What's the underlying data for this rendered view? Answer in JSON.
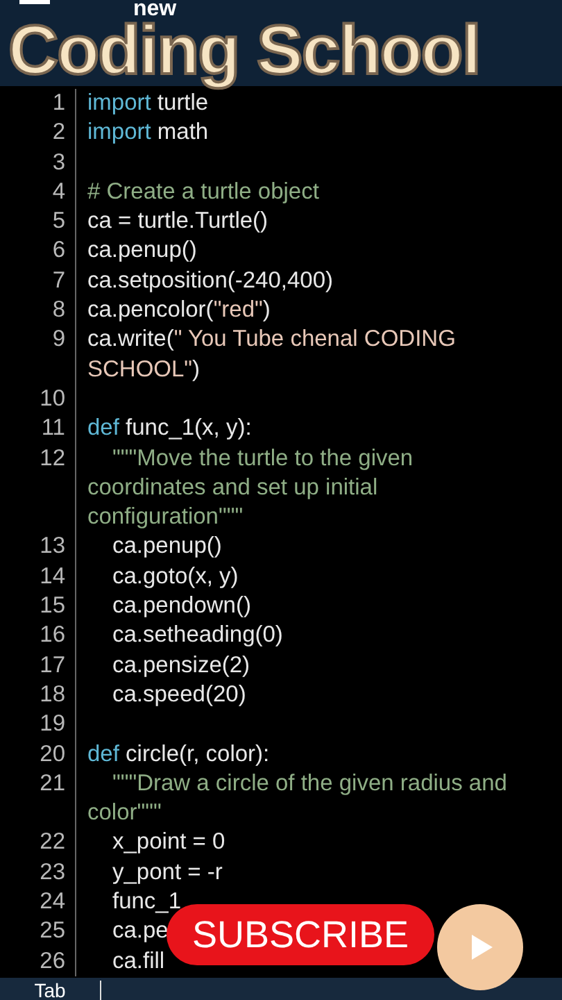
{
  "app_bar": {
    "title": "new"
  },
  "overlay_title": "Coding School",
  "lines": [
    {
      "number": "1",
      "indented": false,
      "parts": [
        {
          "kind": "keyword",
          "text": "import"
        },
        {
          "kind": "plain",
          "text": " turtle"
        }
      ]
    },
    {
      "number": "2",
      "indented": false,
      "parts": [
        {
          "kind": "keyword",
          "text": "import"
        },
        {
          "kind": "plain",
          "text": " math"
        }
      ]
    },
    {
      "number": "3"
    },
    {
      "number": "4",
      "indented": false,
      "parts": [
        {
          "kind": "comment",
          "text": "# Create a turtle object"
        }
      ]
    },
    {
      "number": "5",
      "indented": false,
      "parts": [
        {
          "kind": "plain",
          "text": "ca = turtle.Turtle()"
        }
      ]
    },
    {
      "number": "6",
      "indented": false,
      "parts": [
        {
          "kind": "plain",
          "text": "ca.penup()"
        }
      ]
    },
    {
      "number": "7",
      "indented": false,
      "parts": [
        {
          "kind": "plain",
          "text": "ca.setposition(-240,400)"
        }
      ]
    },
    {
      "number": "8",
      "indented": false,
      "parts": [
        {
          "kind": "plain",
          "text": "ca.pencolor("
        },
        {
          "kind": "string",
          "text": "\"red\""
        },
        {
          "kind": "plain",
          "text": ")"
        }
      ]
    },
    {
      "number": "9",
      "indented": false,
      "parts": [
        {
          "kind": "plain",
          "text": "ca.write("
        },
        {
          "kind": "string",
          "text": "\" You Tube chenal CODING SCHOOL\""
        },
        {
          "kind": "plain",
          "text": ")"
        }
      ]
    },
    {
      "number": "10"
    },
    {
      "number": "11",
      "indented": false,
      "parts": [
        {
          "kind": "keyword",
          "text": "def"
        },
        {
          "kind": "plain",
          "text": " func_1(x, y):"
        }
      ]
    },
    {
      "number": "12",
      "indented": true,
      "parts": [
        {
          "kind": "comment",
          "text": "\"\"\"Move the turtle to the given coordinates and set up initial configuration\"\"\""
        }
      ]
    },
    {
      "number": "13",
      "indented": true,
      "parts": [
        {
          "kind": "plain",
          "text": "ca.penup()"
        }
      ]
    },
    {
      "number": "14",
      "indented": true,
      "parts": [
        {
          "kind": "plain",
          "text": "ca.goto(x, y)"
        }
      ]
    },
    {
      "number": "15",
      "indented": true,
      "parts": [
        {
          "kind": "plain",
          "text": "ca.pendown()"
        }
      ]
    },
    {
      "number": "16",
      "indented": true,
      "parts": [
        {
          "kind": "plain",
          "text": "ca.setheading(0)"
        }
      ]
    },
    {
      "number": "17",
      "indented": true,
      "parts": [
        {
          "kind": "plain",
          "text": "ca.pensize(2)"
        }
      ]
    },
    {
      "number": "18",
      "indented": true,
      "parts": [
        {
          "kind": "plain",
          "text": "ca.speed(20)"
        }
      ]
    },
    {
      "number": "19"
    },
    {
      "number": "20",
      "indented": false,
      "parts": [
        {
          "kind": "keyword",
          "text": "def"
        },
        {
          "kind": "plain",
          "text": " circle(r, color):"
        }
      ]
    },
    {
      "number": "21",
      "indented": true,
      "parts": [
        {
          "kind": "comment",
          "text": "\"\"\"Draw a circle of the given radius and color\"\"\""
        }
      ]
    },
    {
      "number": "22",
      "indented": true,
      "parts": [
        {
          "kind": "plain",
          "text": "x_point = 0"
        }
      ]
    },
    {
      "number": "23",
      "indented": true,
      "parts": [
        {
          "kind": "plain",
          "text": "y_pont = -r"
        }
      ]
    },
    {
      "number": "24",
      "indented": true,
      "parts": [
        {
          "kind": "plain",
          "text": "func_1"
        }
      ]
    },
    {
      "number": "25",
      "indented": true,
      "parts": [
        {
          "kind": "plain",
          "text": "ca.pe"
        }
      ]
    },
    {
      "number": "26",
      "indented": true,
      "parts": [
        {
          "kind": "plain",
          "text": "ca.fill"
        }
      ]
    }
  ],
  "subscribe_button": "SUBSCRIBE",
  "keys": [
    "Tab"
  ]
}
